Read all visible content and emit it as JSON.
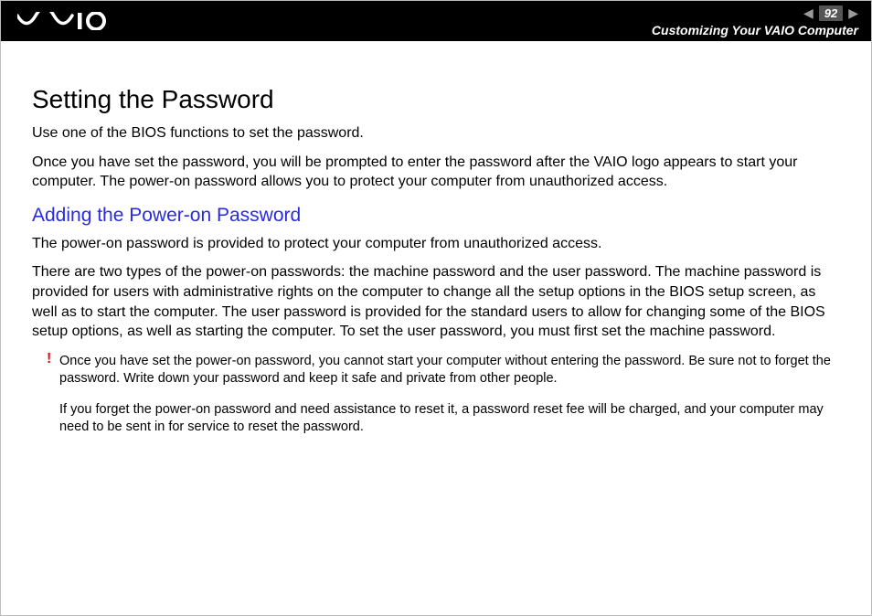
{
  "header": {
    "page_number": "92",
    "breadcrumb": "Customizing Your VAIO Computer"
  },
  "content": {
    "title": "Setting the Password",
    "intro_1": "Use one of the BIOS functions to set the password.",
    "intro_2": "Once you have set the password, you will be prompted to enter the password after the VAIO logo appears to start your computer. The power-on password allows you to protect your computer from unauthorized access.",
    "subheading": "Adding the Power-on Password",
    "sub_1": "The power-on password is provided to protect your computer from unauthorized access.",
    "sub_2": "There are two types of the power-on passwords: the machine password and the user password. The machine password is provided for users with administrative rights on the computer to change all the setup options in the BIOS setup screen, as well as to start the computer. The user password is provided for the standard users to allow for changing some of the BIOS setup options, as well as starting the computer. To set the user password, you must first set the machine password.",
    "warning_mark": "!",
    "note_1": "Once you have set the power-on password, you cannot start your computer without entering the password. Be sure not to forget the password. Write down your password and keep it safe and private from other people.",
    "note_2": "If you forget the power-on password and need assistance to reset it, a password reset fee will be charged, and your computer may need to be sent in for service to reset the password."
  }
}
